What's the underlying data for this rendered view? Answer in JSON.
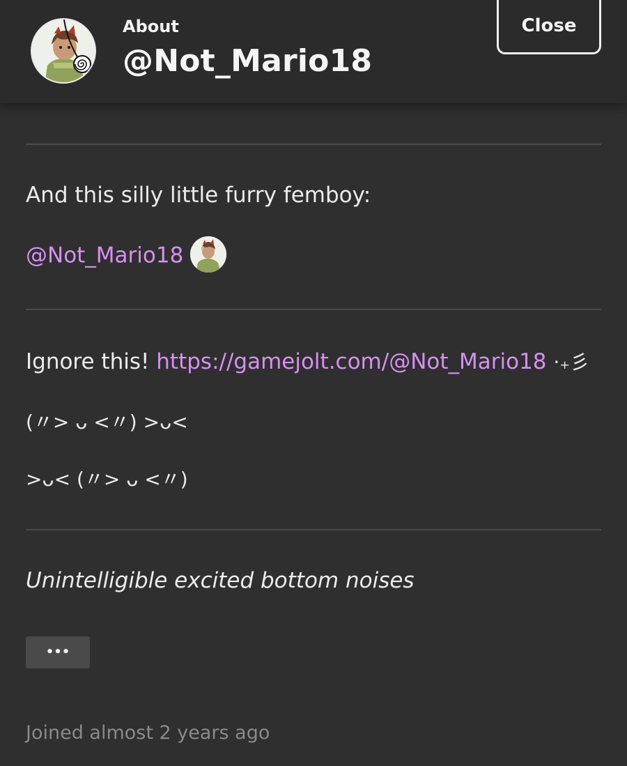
{
  "header": {
    "label": "About",
    "username": "@Not_Mario18",
    "close_label": "Close"
  },
  "sections": {
    "intro": "And this silly little furry femboy:",
    "mention": "@Not_Mario18",
    "ignore_prefix": "Ignore this!",
    "ignore_link": "https://gamejolt.com/@Not_Mario18",
    "ignore_suffix": "·₊彡",
    "kaomoji_line_1": "(〃> ᴗ <〃) >ᴗ<",
    "kaomoji_line_2": ">ᴗ< (〃> ᴗ <〃)",
    "tagline": "Unintelligible excited bottom noises"
  },
  "more_button_label": "•••",
  "joined_text": "Joined almost 2 years ago",
  "colors": {
    "background": "#2f2f2f",
    "header_bg": "#2b2b2b",
    "link": "#d78ff2",
    "divider": "#4a4a4a",
    "muted_text": "#8a8a8a"
  }
}
